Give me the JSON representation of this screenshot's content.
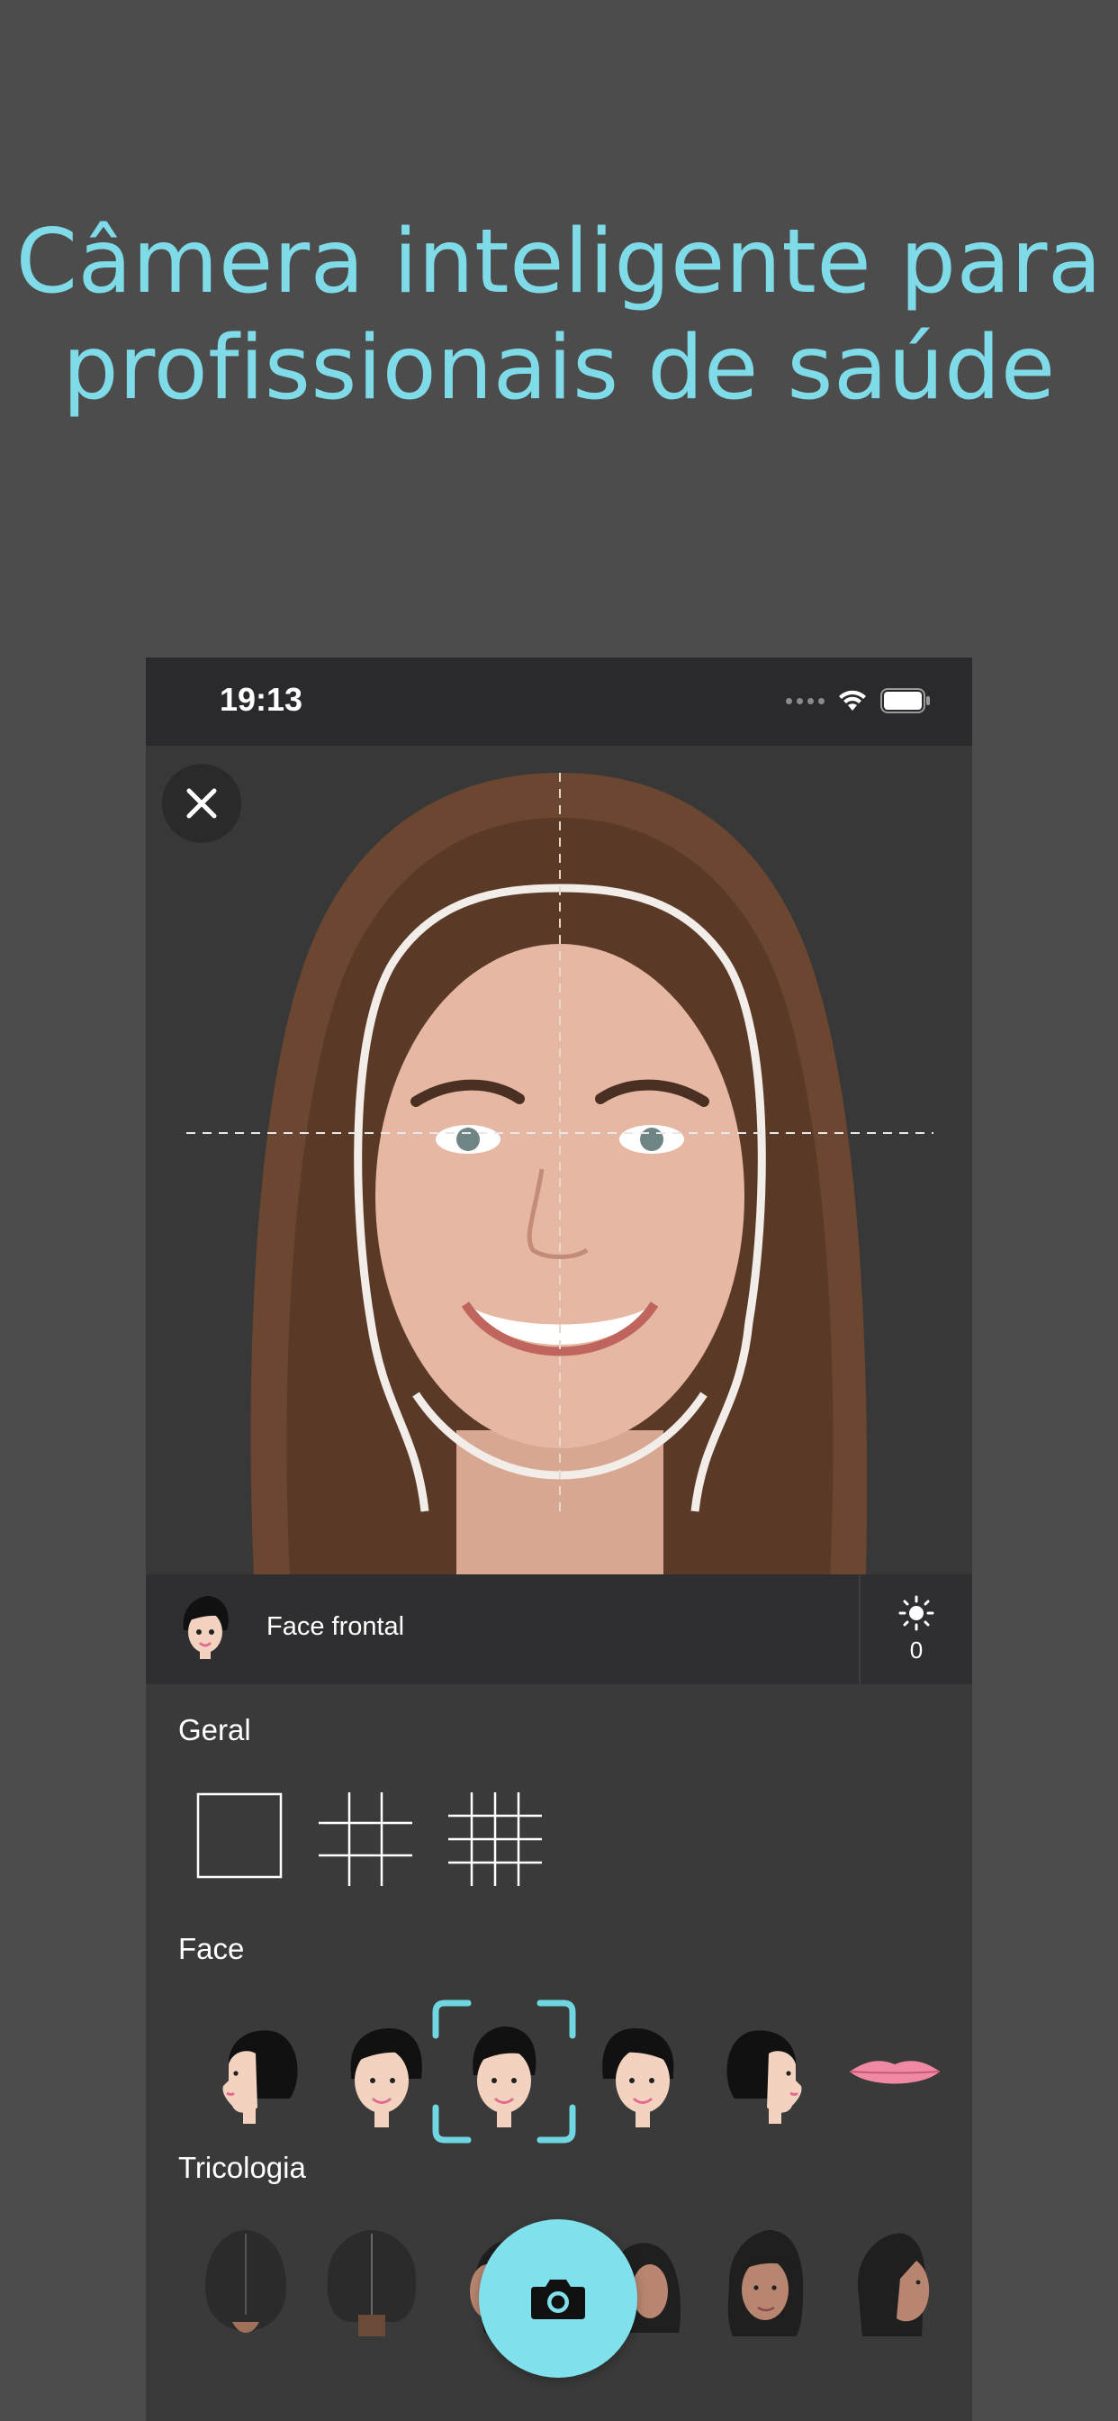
{
  "headline": {
    "line1": "Câmera inteligente para",
    "line2": "profissionais de saúde"
  },
  "status_bar": {
    "time": "19:13"
  },
  "viewer": {
    "close_icon": "close-icon",
    "overlay": "face-outline-with-crosshair"
  },
  "info_bar": {
    "current_mode": "Face frontal",
    "brightness_value": "0",
    "brightness_icon": "sun-icon"
  },
  "sections": {
    "geral": {
      "title": "Geral",
      "options": [
        "grid-none-icon",
        "grid-3x3-icon",
        "grid-4x4-icon"
      ]
    },
    "face": {
      "title": "Face",
      "options": [
        "face-profile-left-icon",
        "face-three-quarter-left-icon",
        "face-frontal-icon",
        "face-three-quarter-right-icon",
        "face-profile-right-icon",
        "lips-icon"
      ],
      "selected": "face-frontal-icon"
    },
    "tricologia": {
      "title": "Tricologia",
      "options": [
        "scalp-top-icon",
        "scalp-back-icon",
        "head-left-icon",
        "head-right-icon",
        "head-three-quarter-icon",
        "head-profile-icon"
      ]
    }
  },
  "camera_button": {
    "icon": "camera-icon"
  },
  "colors": {
    "accent": "#7fdbe7",
    "background": "#4c4c4c",
    "panel": "#3a3a3a"
  }
}
